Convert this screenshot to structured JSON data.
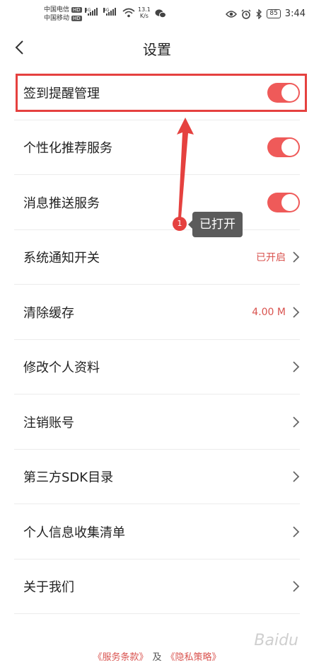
{
  "status_bar": {
    "carrier1": "中国电信",
    "carrier2": "中国移动",
    "hd": "HD",
    "network": "4G",
    "speed_value": "13.1",
    "speed_unit": "K/s",
    "battery": "85",
    "time": "3:44"
  },
  "header": {
    "title": "设置"
  },
  "settings": [
    {
      "label": "签到提醒管理",
      "type": "toggle",
      "on": true
    },
    {
      "label": "个性化推荐服务",
      "type": "toggle",
      "on": true
    },
    {
      "label": "消息推送服务",
      "type": "toggle",
      "on": true
    },
    {
      "label": "系统通知开关",
      "type": "link",
      "value": "已开启"
    },
    {
      "label": "清除缓存",
      "type": "link",
      "value": "4.00 M"
    },
    {
      "label": "修改个人资料",
      "type": "link",
      "value": ""
    },
    {
      "label": "注销账号",
      "type": "link",
      "value": ""
    },
    {
      "label": "第三方SDK目录",
      "type": "link",
      "value": ""
    },
    {
      "label": "个人信息收集清单",
      "type": "link",
      "value": ""
    },
    {
      "label": "关于我们",
      "type": "link",
      "value": ""
    }
  ],
  "annotation": {
    "badge": "1",
    "tooltip": "已打开"
  },
  "footer": {
    "terms": "《服务条款》",
    "and": "及",
    "privacy": "《隐私策略》"
  },
  "watermark": "Baidu",
  "colors": {
    "accent": "#ef5a59",
    "annotation": "#e5413f"
  }
}
